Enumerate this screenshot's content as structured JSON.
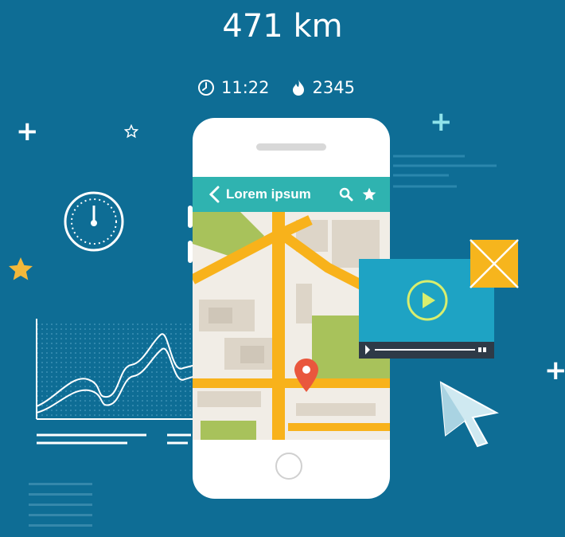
{
  "header": {
    "distance": "471 km"
  },
  "stats": {
    "time": "11:22",
    "calories": "2345"
  },
  "app": {
    "title": "Lorem ipsum"
  },
  "icons": [
    "clock-icon",
    "flame-icon",
    "back-icon",
    "search-icon",
    "star-icon",
    "play-icon",
    "envelope-icon",
    "cursor-icon",
    "speedometer-icon",
    "map-pin-icon",
    "plus-icon"
  ],
  "colors": {
    "background": "#0e6d95",
    "appbar": "#2fb3b0",
    "map_road": "#f8b21b",
    "pin": "#e9573d",
    "video": "#1ea3c4",
    "envelope": "#f6b51d",
    "star": "#f3b83a"
  }
}
